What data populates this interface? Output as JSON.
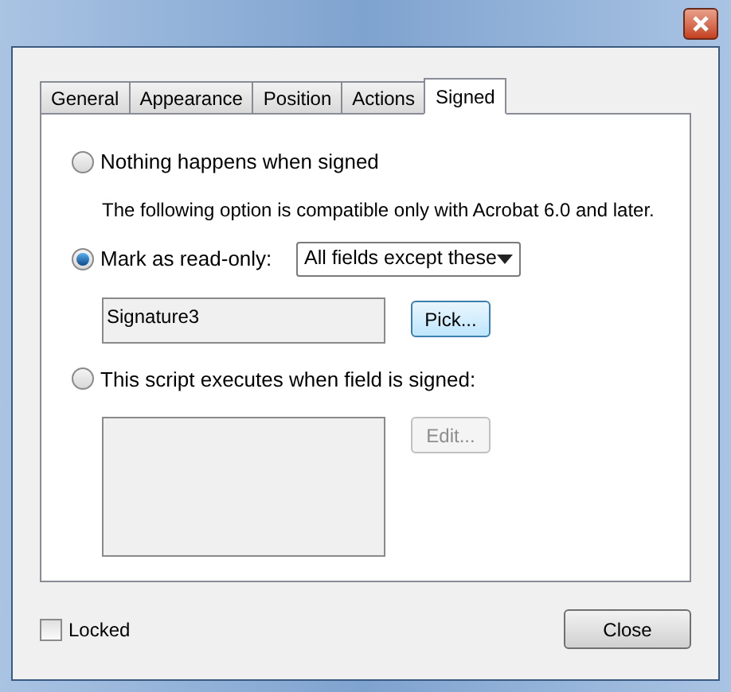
{
  "tabs": [
    {
      "label": "General",
      "selected": false
    },
    {
      "label": "Appearance",
      "selected": false
    },
    {
      "label": "Position",
      "selected": false
    },
    {
      "label": "Actions",
      "selected": false
    },
    {
      "label": "Signed",
      "selected": true
    }
  ],
  "options": [
    {
      "label": "Nothing happens when signed",
      "selected": false
    },
    {
      "label": "Mark as read-only:",
      "selected": true
    },
    {
      "label": "This script executes when field is signed:",
      "selected": false
    }
  ],
  "compat_note": "The following option is compatible only with Acrobat 6.0 and later.",
  "readonly_select": {
    "value": "All fields except these"
  },
  "fields_box": {
    "value": "Signature3"
  },
  "pick_button": {
    "label": "Pick...",
    "disabled": false
  },
  "edit_button": {
    "label": "Edit...",
    "disabled": true
  },
  "locked": {
    "label": "Locked",
    "checked": false
  },
  "close_button": {
    "label": "Close"
  }
}
